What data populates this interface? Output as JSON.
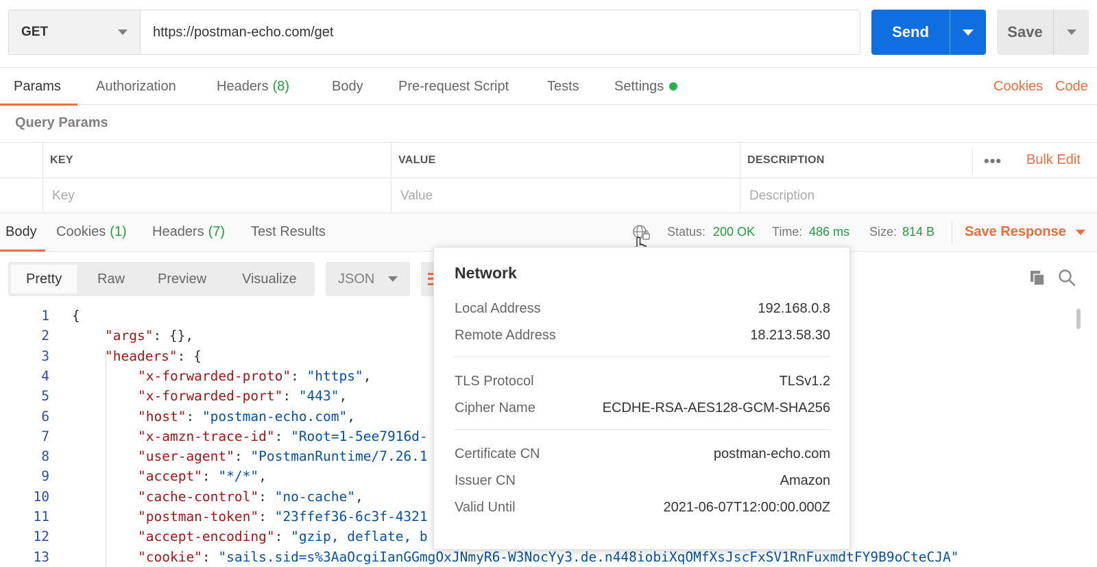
{
  "request": {
    "method": "GET",
    "url": "https://postman-echo.com/get",
    "send_label": "Send",
    "save_label": "Save"
  },
  "request_tabs": {
    "params": "Params",
    "authorization": "Authorization",
    "headers": "Headers",
    "headers_count": "(8)",
    "body": "Body",
    "prerequest": "Pre-request Script",
    "tests": "Tests",
    "settings": "Settings",
    "cookies": "Cookies",
    "code": "Code"
  },
  "query_params": {
    "title": "Query Params",
    "columns": [
      "KEY",
      "VALUE",
      "DESCRIPTION"
    ],
    "placeholders": [
      "Key",
      "Value",
      "Description"
    ],
    "bulk_edit": "Bulk Edit",
    "more": "•••"
  },
  "response_tabs": {
    "body": "Body",
    "cookies": "Cookies",
    "cookies_count": "(1)",
    "headers": "Headers",
    "headers_count": "(7)",
    "test_results": "Test Results"
  },
  "response_stats": {
    "status_label": "Status:",
    "status_value": "200 OK",
    "time_label": "Time:",
    "time_value": "486 ms",
    "size_label": "Size:",
    "size_value": "814 B",
    "save_response": "Save Response"
  },
  "view_modes": [
    "Pretty",
    "Raw",
    "Preview",
    "Visualize"
  ],
  "format": "JSON",
  "colors": {
    "accent_orange": "#f26b3a",
    "send_blue": "#0f6fde",
    "success_green": "#1e9e3b"
  },
  "network_popover": {
    "title": "Network",
    "rows": [
      {
        "label": "Local Address",
        "value": "192.168.0.8"
      },
      {
        "label": "Remote Address",
        "value": "18.213.58.30"
      },
      {
        "label": "TLS Protocol",
        "value": "TLSv1.2"
      },
      {
        "label": "Cipher Name",
        "value": "ECDHE-RSA-AES128-GCM-SHA256"
      },
      {
        "label": "Certificate CN",
        "value": "postman-echo.com"
      },
      {
        "label": "Issuer CN",
        "value": "Amazon"
      },
      {
        "label": "Valid Until",
        "value": "2021-06-07T12:00:00.000Z"
      }
    ]
  },
  "code_lines": [
    {
      "n": "1",
      "indent": 0,
      "parts": [
        [
          "p",
          "{"
        ]
      ]
    },
    {
      "n": "2",
      "indent": 1,
      "parts": [
        [
          "k",
          "\"args\""
        ],
        [
          "p",
          ": {},"
        ]
      ]
    },
    {
      "n": "3",
      "indent": 1,
      "parts": [
        [
          "k",
          "\"headers\""
        ],
        [
          "p",
          ": {"
        ]
      ]
    },
    {
      "n": "4",
      "indent": 2,
      "parts": [
        [
          "k",
          "\"x-forwarded-proto\""
        ],
        [
          "p",
          ": "
        ],
        [
          "s",
          "\"https\""
        ],
        [
          "p",
          ","
        ]
      ]
    },
    {
      "n": "5",
      "indent": 2,
      "parts": [
        [
          "k",
          "\"x-forwarded-port\""
        ],
        [
          "p",
          ": "
        ],
        [
          "s",
          "\"443\""
        ],
        [
          "p",
          ","
        ]
      ]
    },
    {
      "n": "6",
      "indent": 2,
      "parts": [
        [
          "k",
          "\"host\""
        ],
        [
          "p",
          ": "
        ],
        [
          "s",
          "\"postman-echo.com\""
        ],
        [
          "p",
          ","
        ]
      ]
    },
    {
      "n": "7",
      "indent": 2,
      "parts": [
        [
          "k",
          "\"x-amzn-trace-id\""
        ],
        [
          "p",
          ": "
        ],
        [
          "s",
          "\"Root=1-5ee7916d-"
        ]
      ]
    },
    {
      "n": "8",
      "indent": 2,
      "parts": [
        [
          "k",
          "\"user-agent\""
        ],
        [
          "p",
          ": "
        ],
        [
          "s",
          "\"PostmanRuntime/7.26.1"
        ]
      ]
    },
    {
      "n": "9",
      "indent": 2,
      "parts": [
        [
          "k",
          "\"accept\""
        ],
        [
          "p",
          ": "
        ],
        [
          "s",
          "\"*/*\""
        ],
        [
          "p",
          ","
        ]
      ]
    },
    {
      "n": "10",
      "indent": 2,
      "parts": [
        [
          "k",
          "\"cache-control\""
        ],
        [
          "p",
          ": "
        ],
        [
          "s",
          "\"no-cache\""
        ],
        [
          "p",
          ","
        ]
      ]
    },
    {
      "n": "11",
      "indent": 2,
      "parts": [
        [
          "k",
          "\"postman-token\""
        ],
        [
          "p",
          ": "
        ],
        [
          "s",
          "\"23ffef36-6c3f-4321"
        ]
      ]
    },
    {
      "n": "12",
      "indent": 2,
      "parts": [
        [
          "k",
          "\"accept-encoding\""
        ],
        [
          "p",
          ": "
        ],
        [
          "s",
          "\"gzip, deflate, b"
        ]
      ]
    },
    {
      "n": "13",
      "indent": 2,
      "parts": [
        [
          "k",
          "\"cookie\""
        ],
        [
          "p",
          ": "
        ],
        [
          "s",
          "\"sails.sid=s%3AaOcgiIanGGmgOxJNmyR6-W3NocYy3.de.n448iobiXqOMfXsJscFxSV1RnFuxmdtFY9B9oCteCJA\""
        ]
      ]
    }
  ]
}
